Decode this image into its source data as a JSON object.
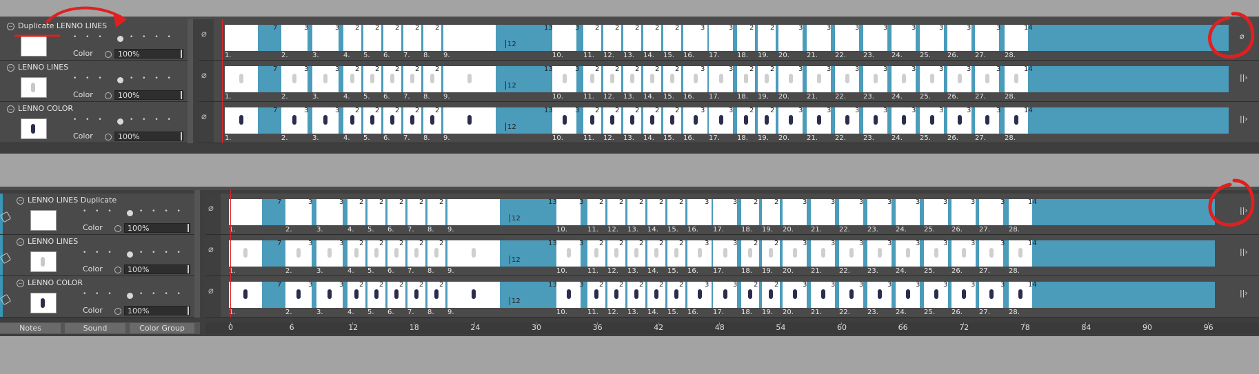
{
  "colors": {
    "accent": "#4b9bbb",
    "playhead": "#e2232a",
    "annotation": "#e02020"
  },
  "panels": [
    {
      "id": "top",
      "layers": [
        {
          "name": "Duplicate LENNO LINES",
          "color_label": "Color",
          "opacity": "100%",
          "end_icon": "no-symbol-icon",
          "style": "blank"
        },
        {
          "name": "LENNO LINES",
          "color_label": "Color",
          "opacity": "100%",
          "end_icon": "cel-end-icon",
          "style": "lines"
        },
        {
          "name": "LENNO COLOR",
          "color_label": "Color",
          "opacity": "100%",
          "end_icon": "cel-end-icon",
          "style": "color"
        }
      ],
      "first_frame_number": "1."
    },
    {
      "id": "bottom",
      "layers": [
        {
          "name": "LENNO LINES Duplicate",
          "color_label": "Color",
          "opacity": "100%",
          "end_icon": "cel-end-icon",
          "style": "blank"
        },
        {
          "name": "LENNO LINES",
          "color_label": "Color",
          "opacity": "100%",
          "end_icon": "cel-end-icon",
          "style": "lines"
        },
        {
          "name": "LENNO COLOR",
          "color_label": "Color",
          "opacity": "100%",
          "end_icon": "cel-end-icon",
          "style": "color"
        }
      ],
      "first_frame_number": "1."
    }
  ],
  "frames": [
    {
      "n": "1.",
      "dur": "7"
    },
    {
      "n": "2.",
      "dur": "3"
    },
    {
      "n": "3.",
      "dur": "3"
    },
    {
      "n": "4.",
      "dur": "2"
    },
    {
      "n": "5.",
      "dur": "2"
    },
    {
      "n": "6.",
      "dur": "2"
    },
    {
      "n": "7.",
      "dur": "2"
    },
    {
      "n": "8.",
      "dur": "2"
    },
    {
      "n": "9.",
      "dur": "13",
      "mid": "12"
    },
    {
      "n": "10.",
      "dur": "3"
    },
    {
      "n": "11.",
      "dur": "2"
    },
    {
      "n": "12.",
      "dur": "2"
    },
    {
      "n": "13.",
      "dur": "2"
    },
    {
      "n": "14.",
      "dur": "2"
    },
    {
      "n": "15.",
      "dur": "2"
    },
    {
      "n": "16.",
      "dur": "3"
    },
    {
      "n": "17.",
      "dur": "3"
    },
    {
      "n": "18.",
      "dur": "2"
    },
    {
      "n": "19.",
      "dur": "2"
    },
    {
      "n": "20.",
      "dur": "3"
    },
    {
      "n": "21.",
      "dur": "3"
    },
    {
      "n": "22.",
      "dur": "3"
    },
    {
      "n": "23.",
      "dur": "3"
    },
    {
      "n": "24.",
      "dur": "3"
    },
    {
      "n": "25.",
      "dur": "3"
    },
    {
      "n": "26.",
      "dur": "3"
    },
    {
      "n": "27.",
      "dur": "3"
    },
    {
      "n": "28.",
      "dur": "14"
    }
  ],
  "bottom_tabs": [
    "Notes",
    "Sound",
    "Color Group"
  ],
  "ruler": [
    "0",
    "6",
    "12",
    "18",
    "24",
    "30",
    "36",
    "42",
    "48",
    "54",
    "60",
    "66",
    "72",
    "78",
    "84",
    "90",
    "96"
  ]
}
